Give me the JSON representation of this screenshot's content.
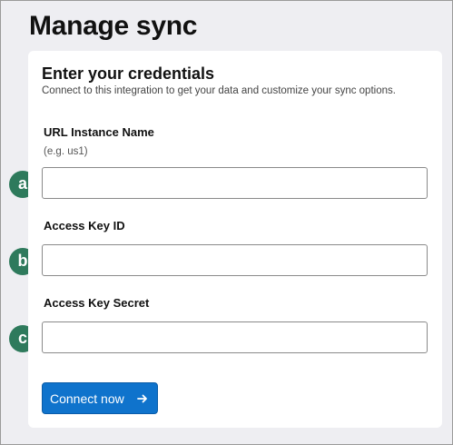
{
  "page": {
    "title": "Manage sync"
  },
  "card": {
    "title": "Enter your credentials",
    "subtitle": "Connect to this integration to get your data and customize your sync options."
  },
  "fields": [
    {
      "label": "URL Instance Name",
      "hint": "(e.g. us1)",
      "value": "",
      "placeholder": "",
      "marker": "a"
    },
    {
      "label": "Access Key ID",
      "value": "",
      "placeholder": "",
      "marker": "b"
    },
    {
      "label": "Access Key Secret",
      "value": "",
      "placeholder": "",
      "marker": "c"
    }
  ],
  "connect_button": {
    "label": "Connect now",
    "icon": "arrow-right-icon"
  },
  "colors": {
    "page_background": "#eeeef2",
    "card_background": "#ffffff",
    "accent": "#0f73cc",
    "marker": "#2e7a5c"
  }
}
